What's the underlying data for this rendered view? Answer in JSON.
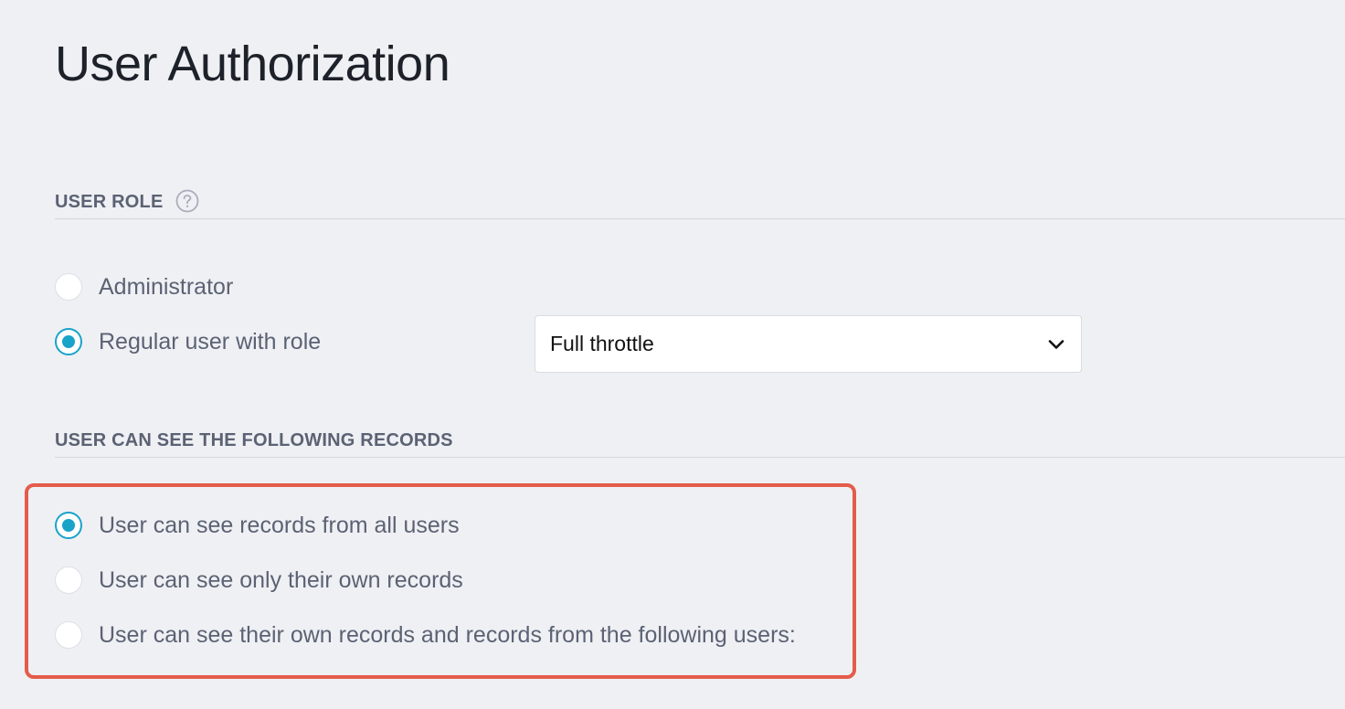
{
  "page": {
    "title": "User Authorization"
  },
  "user_role": {
    "header": "USER ROLE",
    "help_icon": "question-circle-icon",
    "options": [
      {
        "label": "Administrator",
        "selected": false
      },
      {
        "label": "Regular user with role",
        "selected": true
      }
    ],
    "role_select": {
      "value": "Full throttle",
      "icon": "chevron-down-icon"
    }
  },
  "records_visibility": {
    "header": "USER CAN SEE THE FOLLOWING RECORDS",
    "options": [
      {
        "label": "User can see records from all users",
        "selected": true
      },
      {
        "label": "User can see only their own records",
        "selected": false
      },
      {
        "label": "User can see their own records and records from the following users:",
        "selected": false
      }
    ]
  },
  "colors": {
    "background": "#eff0f4",
    "accent": "#1aa3c9",
    "highlight_border": "#e45c4b",
    "title_text": "#1d2129",
    "body_text": "#5b6273"
  }
}
